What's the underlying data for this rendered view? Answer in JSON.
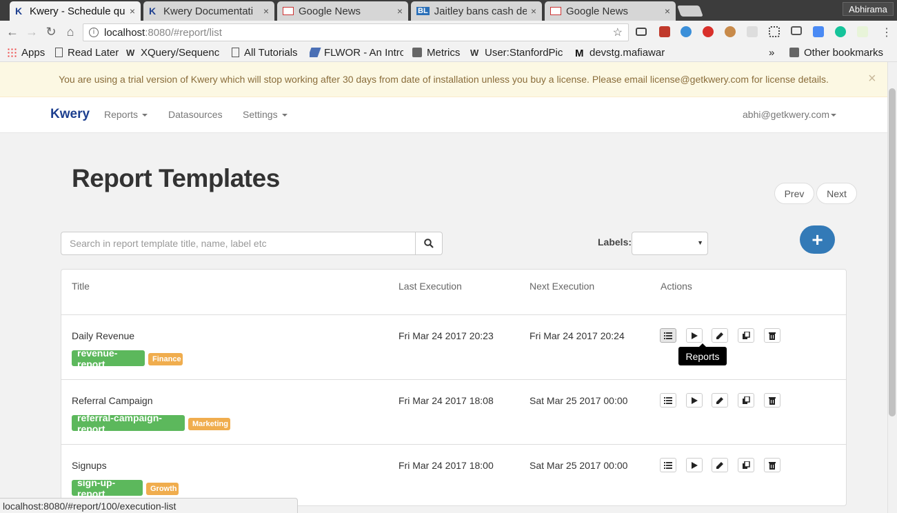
{
  "browser": {
    "tabs": [
      {
        "title": "Kwery - Schedule qu",
        "favicon": "kwery-icon",
        "active": true
      },
      {
        "title": "Kwery Documentati",
        "favicon": "kwery-icon",
        "active": false
      },
      {
        "title": "Google News",
        "favicon": "google-news-icon",
        "active": false
      },
      {
        "title": "Jaitley bans cash de",
        "favicon": "bl-icon",
        "active": false
      },
      {
        "title": "Google News",
        "favicon": "google-news-icon",
        "active": false
      }
    ],
    "tab_close": "×",
    "profile_name": "Abhirama",
    "url_host": "localhost",
    "url_path": ":8080/#report/list",
    "bookmarks": [
      {
        "label": "Apps",
        "icon": "apps-grid-icon"
      },
      {
        "label": "Read Later",
        "icon": "page-icon"
      },
      {
        "label": "XQuery/Sequenc",
        "icon": "wiki-icon"
      },
      {
        "label": "All Tutorials",
        "icon": "page-icon"
      },
      {
        "label": "FLWOR - An Intro",
        "icon": "flwor-icon"
      },
      {
        "label": "Metrics",
        "icon": "folder-icon"
      },
      {
        "label": "User:StanfordPic",
        "icon": "wiki-icon"
      },
      {
        "label": "devstg.mafiawar",
        "icon": "m-icon"
      }
    ],
    "bookmarks_overflow": "»",
    "other_bookmarks": "Other bookmarks",
    "status_url": "localhost:8080/#report/100/execution-list"
  },
  "alert": {
    "text": "You are using a trial version of Kwery which will stop working after 30 days from date of installation unless you buy a license. Please email license@getkwery.com for license details.",
    "close": "×"
  },
  "navbar": {
    "brand": "Kwery",
    "reports": "Reports",
    "datasources": "Datasources",
    "settings": "Settings",
    "user": "abhi@getkwery.com"
  },
  "main": {
    "title": "Report Templates",
    "prev": "Prev",
    "next": "Next",
    "search_placeholder": "Search in report template title, name, label etc",
    "labels_label": "Labels:",
    "labels_value": "",
    "add_symbol": "+",
    "columns": [
      "Title",
      "Last Execution",
      "Next Execution",
      "Actions"
    ],
    "rows": [
      {
        "title": "Daily Revenue",
        "name": "revenue-report",
        "label": "Finance",
        "last": "Fri Mar 24 2017 20:23",
        "next": "Fri Mar 24 2017 20:24"
      },
      {
        "title": "Referral Campaign",
        "name": "referral-campaign-report",
        "label": "Marketing",
        "last": "Fri Mar 24 2017 18:08",
        "next": "Sat Mar 25 2017 00:00"
      },
      {
        "title": "Signups",
        "name": "sign-up-report",
        "label": "Growth",
        "last": "Fri Mar 24 2017 18:00",
        "next": "Sat Mar 25 2017 00:00"
      }
    ],
    "tooltip": "Reports"
  },
  "colors": {
    "brand": "#1d3f8f",
    "primary": "#337ab7",
    "tag_green": "#5cb85c",
    "tag_orange": "#f0ad4e",
    "alert_bg": "#fcf8e3",
    "alert_text": "#8a6d3b"
  }
}
